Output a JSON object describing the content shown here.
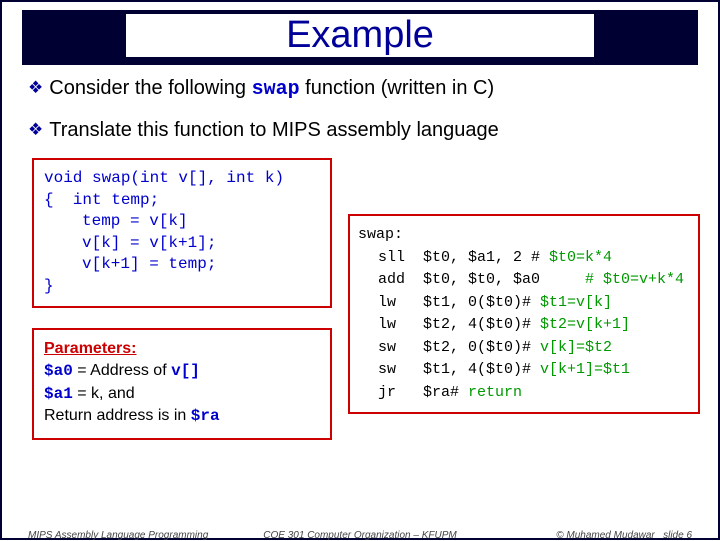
{
  "title": "Example",
  "bullet1_pre": "Consider the following ",
  "bullet1_code": "swap",
  "bullet1_post": " function (written in C)",
  "bullet2": "Translate this function to MIPS assembly language",
  "ccode": {
    "l1a": "void swap(int v[], int k)",
    "l2a": "{  int temp;",
    "l3a": "temp = v[k]",
    "l4a": "v[k] = v[k+1];",
    "l5a": "v[k+1] = temp;",
    "l6a": "}"
  },
  "params": {
    "heading": "Parameters:",
    "a0": "$a0",
    "a0txt_pre": " = Address of ",
    "a0arr": "v[]",
    "a1": "$a1",
    "a1txt": " = k, and",
    "ra_pre": "Return address is in ",
    "ra": "$ra"
  },
  "mips": {
    "label": "swap:",
    "r1": "sll  $t0, $a1, 2 # ",
    "r1c": "$t0=k*4",
    "r2": "add  $t0, $t0, $a0     ",
    "r2c": "# $t0=v+k*4",
    "r3": "lw   $t1, 0($t0)# ",
    "r3c": "$t1=v[k]",
    "r4": "lw   $t2, 4($t0)# ",
    "r4c": "$t2=v[k+1]",
    "r5": "sw   $t2, 0($t0)# ",
    "r5c": "v[k]=$t2",
    "r6": "sw   $t1, 4($t0)# ",
    "r6c": "v[k+1]=$t1",
    "r7": "jr   $ra# ",
    "r7c": "return"
  },
  "footer": {
    "left": "MIPS Assembly Language Programming",
    "center": "COE 301 Computer Organization – KFUPM",
    "right_a": "© Muhamed Mudawar",
    "right_b": "slide 6"
  }
}
